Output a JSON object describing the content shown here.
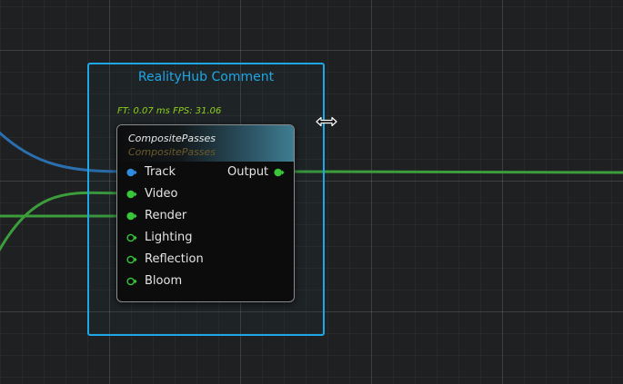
{
  "colors": {
    "canvas_bg": "#1f2021",
    "comment_border": "#1ea7e6",
    "link_blue": "#2a6fb0",
    "link_green": "#3c9d3c",
    "pin_blue": "#2f8de0",
    "pin_green": "#39c63a",
    "fps_text": "#8fd21c"
  },
  "comment": {
    "title": "RealityHub Comment"
  },
  "stats": {
    "frame_time": "FT: 0.07 ms FPS: 31.06"
  },
  "node": {
    "title": "CompositePasses",
    "subtitle": "CompositePasses",
    "inputs": [
      {
        "label": "Track",
        "pin_type": "blue-filled",
        "connected": true
      },
      {
        "label": "Video",
        "pin_type": "green-filled",
        "connected": true
      },
      {
        "label": "Render",
        "pin_type": "green-filled",
        "connected": true
      },
      {
        "label": "Lighting",
        "pin_type": "green-hollow",
        "connected": false
      },
      {
        "label": "Reflection",
        "pin_type": "green-hollow",
        "connected": false
      },
      {
        "label": "Bloom",
        "pin_type": "green-hollow",
        "connected": false
      }
    ],
    "outputs": [
      {
        "label": "Output",
        "pin_type": "green-filled",
        "connected": true
      }
    ]
  },
  "cursor": {
    "icon": "resize-horizontal-cursor-icon"
  }
}
